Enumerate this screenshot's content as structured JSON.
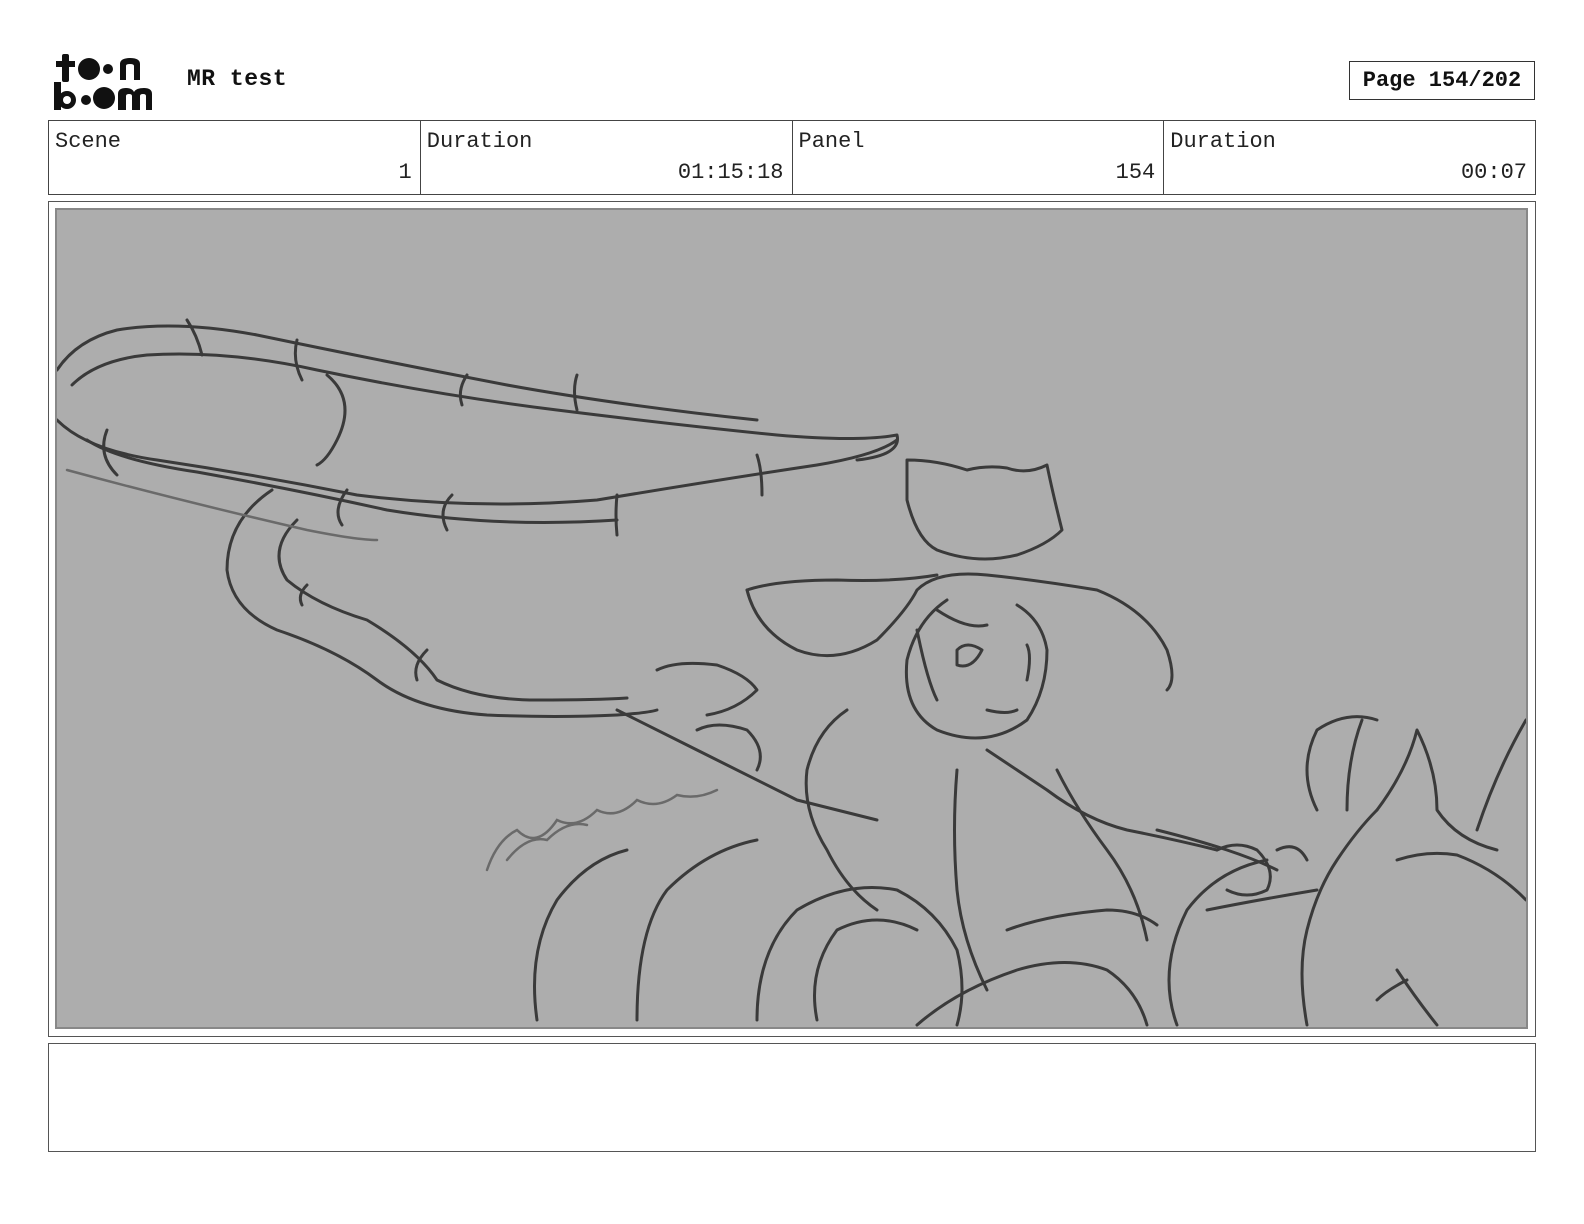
{
  "header": {
    "logo": {
      "text_top": "toon",
      "text_bottom": "boom",
      "icon": "toon-boom-logo"
    },
    "project_title": "MR test",
    "page_indicator": "Page 154/202"
  },
  "info": {
    "scene_label": "Scene",
    "scene_value": "1",
    "scene_duration_label": "Duration",
    "scene_duration_value": "01:15:18",
    "panel_label": "Panel",
    "panel_value": "154",
    "panel_duration_label": "Duration",
    "panel_duration_value": "00:07"
  },
  "panel": {
    "sketch": "storyboard-sketch-image",
    "background_color": "#adadad"
  },
  "notes": {
    "text": ""
  }
}
